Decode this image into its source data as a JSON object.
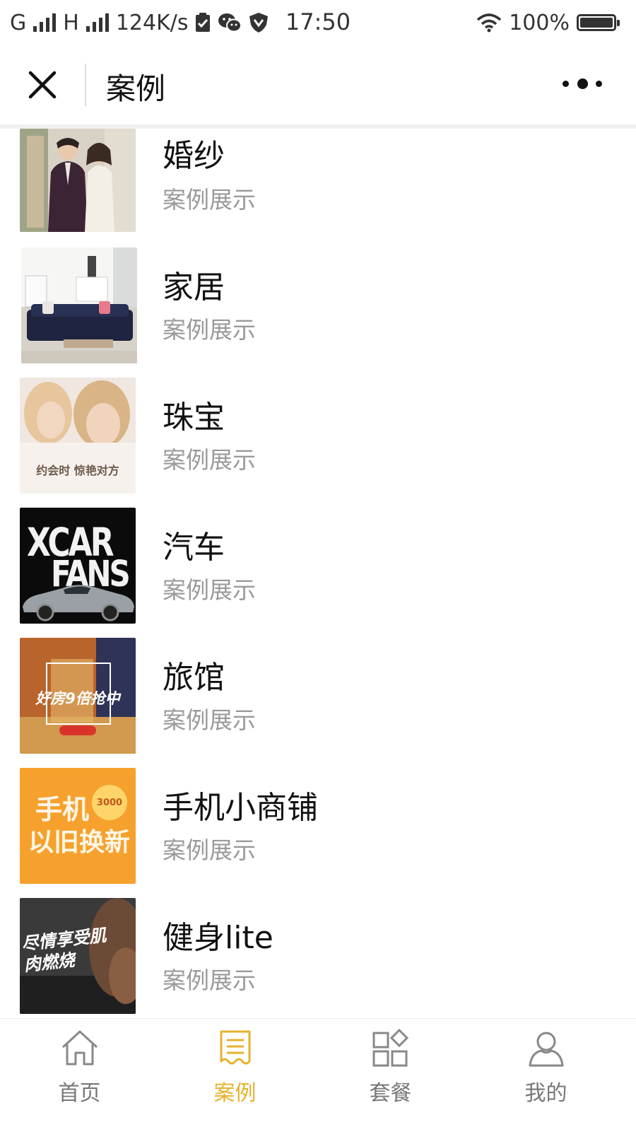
{
  "status_bar": {
    "carrier_1": "G",
    "carrier_2": "H",
    "speed": "124K/s",
    "time": "17:50",
    "battery": "100%"
  },
  "nav": {
    "title": "案例",
    "close_icon": "close-icon",
    "more_icon": "more-icon"
  },
  "list": {
    "items": [
      {
        "title": "婚纱",
        "subtitle": "案例展示"
      },
      {
        "title": "家居",
        "subtitle": "案例展示"
      },
      {
        "title": "珠宝",
        "subtitle": "案例展示",
        "thumb_text": "约会时 惊艳对方"
      },
      {
        "title": "汽车",
        "subtitle": "案例展示",
        "thumb_text_1": "XCAR",
        "thumb_text_2": "FANS"
      },
      {
        "title": "旅馆",
        "subtitle": "案例展示",
        "thumb_text": "好房9倍抢中"
      },
      {
        "title": "手机小商铺",
        "subtitle": "案例展示",
        "thumb_text_1": "手机",
        "thumb_text_2": "以旧换新",
        "thumb_badge": "3000"
      },
      {
        "title": "健身lite",
        "subtitle": "案例展示",
        "thumb_text": "尽情享受肌肉燃烧"
      }
    ]
  },
  "tabbar": {
    "accent_color": "#e6b22d",
    "tabs": [
      {
        "label": "首页",
        "icon": "home-icon"
      },
      {
        "label": "案例",
        "icon": "document-icon",
        "active": true
      },
      {
        "label": "套餐",
        "icon": "grid-icon"
      },
      {
        "label": "我的",
        "icon": "user-icon"
      }
    ]
  }
}
